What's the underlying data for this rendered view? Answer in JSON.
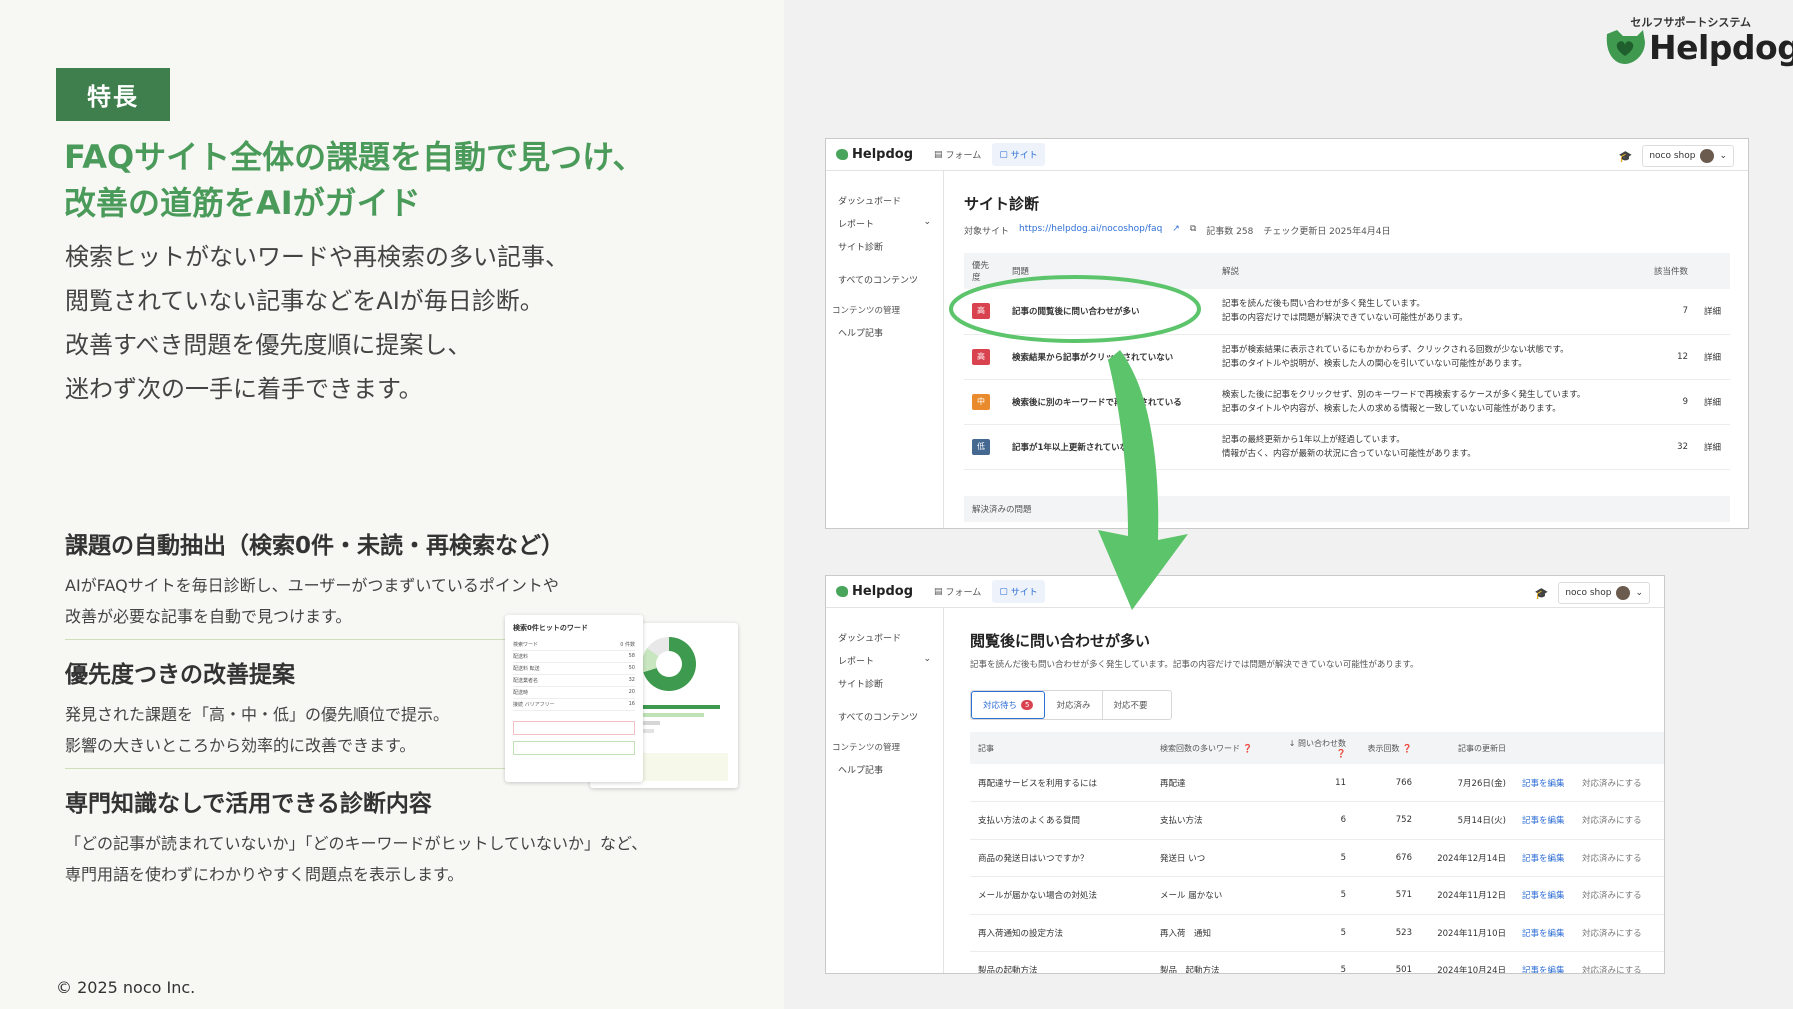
{
  "badge": "特長",
  "headline": [
    "FAQサイト全体の課題を自動で見つけ、",
    "改善の道筋をAIがガイド"
  ],
  "lead": [
    "検索ヒットがないワードや再検索の多い記事、",
    "閲覧されていない記事などをAIが毎日診断。",
    "改善すべき問題を優先度順に提案し、",
    "迷わず次の一手に着手できます。"
  ],
  "features": [
    {
      "title": "課題の自動抽出（検索0件・未読・再検索など）",
      "lines": [
        "AIがFAQサイトを毎日診断し、ユーザーがつまずいているポイントや",
        "改善が必要な記事を自動で見つけます。"
      ]
    },
    {
      "title": "優先度つきの改善提案",
      "lines": [
        "発見された課題を「高・中・低」の優先順位で提示。",
        "影響の大きいところから効率的に改善できます。"
      ]
    },
    {
      "title": "専門知識なしで活用できる診断内容",
      "lines": [
        "「どの記事が読まれていないか」「どのキーワードがヒットしていないか」など、",
        "専門用語を使わずにわかりやすく問題点を表示します。"
      ]
    }
  ],
  "thumb": {
    "title": "検索0件ヒットのワード",
    "header": [
      "検索ワード",
      "0 件数"
    ],
    "rows": [
      [
        "配送料",
        "58"
      ],
      [
        "配送料 転送",
        "50"
      ],
      [
        "配送業者名",
        "32"
      ],
      [
        "配送時",
        "20"
      ],
      [
        "接続 バリアフリー",
        "16"
      ]
    ]
  },
  "copyright": "© 2025 noco Inc.",
  "logo": {
    "sub": "セルフサポートシステム",
    "main": "Helpdog"
  },
  "app": {
    "brand": "Helpdog",
    "tabs": [
      "フォーム",
      "サイト"
    ],
    "shop": "noco shop",
    "sidebar": [
      "ダッシュボード",
      "レポート",
      "サイト診断",
      "すべてのコンテンツ",
      "コンテンツの管理",
      "ヘルプ記事"
    ]
  },
  "diagnosis": {
    "title": "サイト診断",
    "target_label": "対象サイト",
    "target_url": "https://helpdog.ai/nocoshop/faq",
    "article_count": "記事数  258",
    "checked": "チェック更新日  2025年4月4日",
    "columns": [
      "優先度",
      "問題",
      "解説",
      "該当件数",
      ""
    ],
    "rows": [
      {
        "prio": "高",
        "level": "high",
        "issue": "記事の閲覧後に問い合わせが多い",
        "desc": [
          "記事を読んだ後も問い合わせが多く発生しています。",
          "記事の内容だけでは問題が解決できていない可能性があります。"
        ],
        "count": "7",
        "link": "詳細"
      },
      {
        "prio": "高",
        "level": "high",
        "issue": "検索結果から記事がクリックされていない",
        "desc": [
          "記事が検索結果に表示されているにもかかわらず、クリックされる回数が少ない状態です。",
          "記事のタイトルや説明が、検索した人の関心を引いていない可能性があります。"
        ],
        "count": "12",
        "link": "詳細"
      },
      {
        "prio": "中",
        "level": "mid",
        "issue": "検索後に別のキーワードで再検索されている",
        "desc": [
          "検索した後に記事をクリックせず、別のキーワードで再検索するケースが多く発生しています。",
          "記事のタイトルや内容が、検索した人の求める情報と一致していない可能性があります。"
        ],
        "count": "9",
        "link": "詳細"
      },
      {
        "prio": "低",
        "level": "low",
        "issue": "記事が1年以上更新されていない",
        "desc": [
          "記事の最終更新から1年以上が経過しています。",
          "情報が古く、内容が最新の状況に合っていない可能性があります。"
        ],
        "count": "32",
        "link": "詳細"
      }
    ],
    "resolved": "解決済みの問題"
  },
  "detail": {
    "title": "閲覧後に問い合わせが多い",
    "subtitle": "記事を読んだ後も問い合わせが多く発生しています。記事の内容だけでは問題が解決できていない可能性があります。",
    "tabs": [
      "対応待ち",
      "対応済み",
      "対応不要"
    ],
    "pending_count": "5",
    "columns": [
      "記事",
      "検索回数の多いワード",
      "問い合わせ数",
      "表示回数",
      "記事の更新日",
      "",
      ""
    ],
    "rows": [
      [
        "再配達サービスを利用するには",
        "再配達",
        "11",
        "766",
        "7月26日(金)",
        "記事を編集",
        "対応済みにする"
      ],
      [
        "支払い方法のよくある質問",
        "支払い方法",
        "6",
        "752",
        "5月14日(火)",
        "記事を編集",
        "対応済みにする"
      ],
      [
        "商品の発送日はいつですか？",
        "発送日 いつ",
        "5",
        "676",
        "2024年12月14日",
        "記事を編集",
        "対応済みにする"
      ],
      [
        "メールが届かない場合の対処法",
        "メール 届かない",
        "5",
        "571",
        "2024年11月12日",
        "記事を編集",
        "対応済みにする"
      ],
      [
        "再入荷通知の設定方法",
        "再入荷　通知",
        "5",
        "523",
        "2024年11月10日",
        "記事を編集",
        "対応済みにする"
      ],
      [
        "製品の起動方法",
        "製品　起動方法",
        "5",
        "501",
        "2024年10月24日",
        "記事を編集",
        "対応済みにする"
      ]
    ]
  },
  "colors": {
    "brand_green": "#3f7f4e",
    "accent_green": "#4a9a5a",
    "arrow_green": "#5cc46a",
    "link_blue": "#2f6fd6",
    "high": "#d9434f",
    "mid": "#e98b2c",
    "low": "#44688f"
  }
}
